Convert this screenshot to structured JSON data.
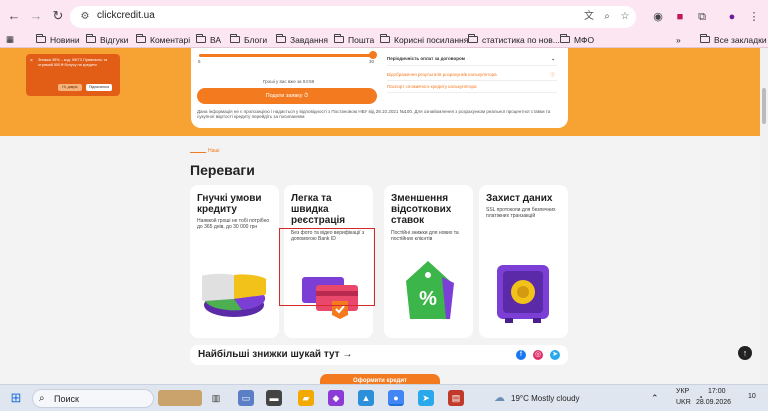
{
  "browser": {
    "url": "clickcredit.ua",
    "bookmarks": [
      "Новини",
      "Відгуки",
      "Коментарі",
      "ВА",
      "Блоги",
      "Завдання",
      "Пошта",
      "Корисні посилання",
      "статистика по нов...",
      "МФО"
    ],
    "all_bookmarks": "Все закладки",
    "overflow": "»"
  },
  "calculator": {
    "slider_min": "5",
    "slider_max": "30",
    "return_text": "Гроші у вас вже за 04:58",
    "submit_label": "Подати заявку",
    "payment_schedule": "Періодичність оплат за договором",
    "link1": "Відображення результатів розрахунків калькулятора",
    "link2": "Паспорт споживчого кредиту калькулятора",
    "disclaimer": "Дана інформація не є пропозицією і надається у відповідності з Постановою НБУ від 28.10.2021 №100. Для ознайомлення з розрахунком реальної процентної ставки та сукупної вартості кредиту перейдіть за посиланням"
  },
  "cookie": {
    "text": "Знижка 35% – код: 9ЖТЗ Привласнь та отримай 500 ₴ бонусу на кредити",
    "decline": "Ні, дякую",
    "accept": "Підписатися"
  },
  "advantages": {
    "section_link": "Наші",
    "title": "Переваги",
    "cards": [
      {
        "title": "Гнучкі умови кредиту",
        "desc": "Наявкой гроші не тобі потрібно до 365 днів, до 30 000 грн"
      },
      {
        "title": "Легка та швидка реєстрація",
        "desc": "Без фото та відео верифікації з допомогою Bank ID"
      },
      {
        "title": "Зменшення відсоткових ставок",
        "desc": "Постійні знижки для нових та постійних клієнтів"
      },
      {
        "title": "Захист даних",
        "desc": "SSL протоколи для безпечних платіжних транзакцій"
      }
    ]
  },
  "promo": {
    "text": "Найбільші знижки шукай тут →",
    "order": "Оформити кредит"
  },
  "taskbar": {
    "search": "Поиск",
    "weather": "19°C  Mostly cloudy",
    "lang1": "УКР",
    "lang2": "UKR",
    "time": "17:00",
    "date": "28.09.2026",
    "notif": "10"
  },
  "colors": {
    "accent": "#f47a20",
    "band": "#f7a334",
    "highlight": "#d42a2a"
  }
}
